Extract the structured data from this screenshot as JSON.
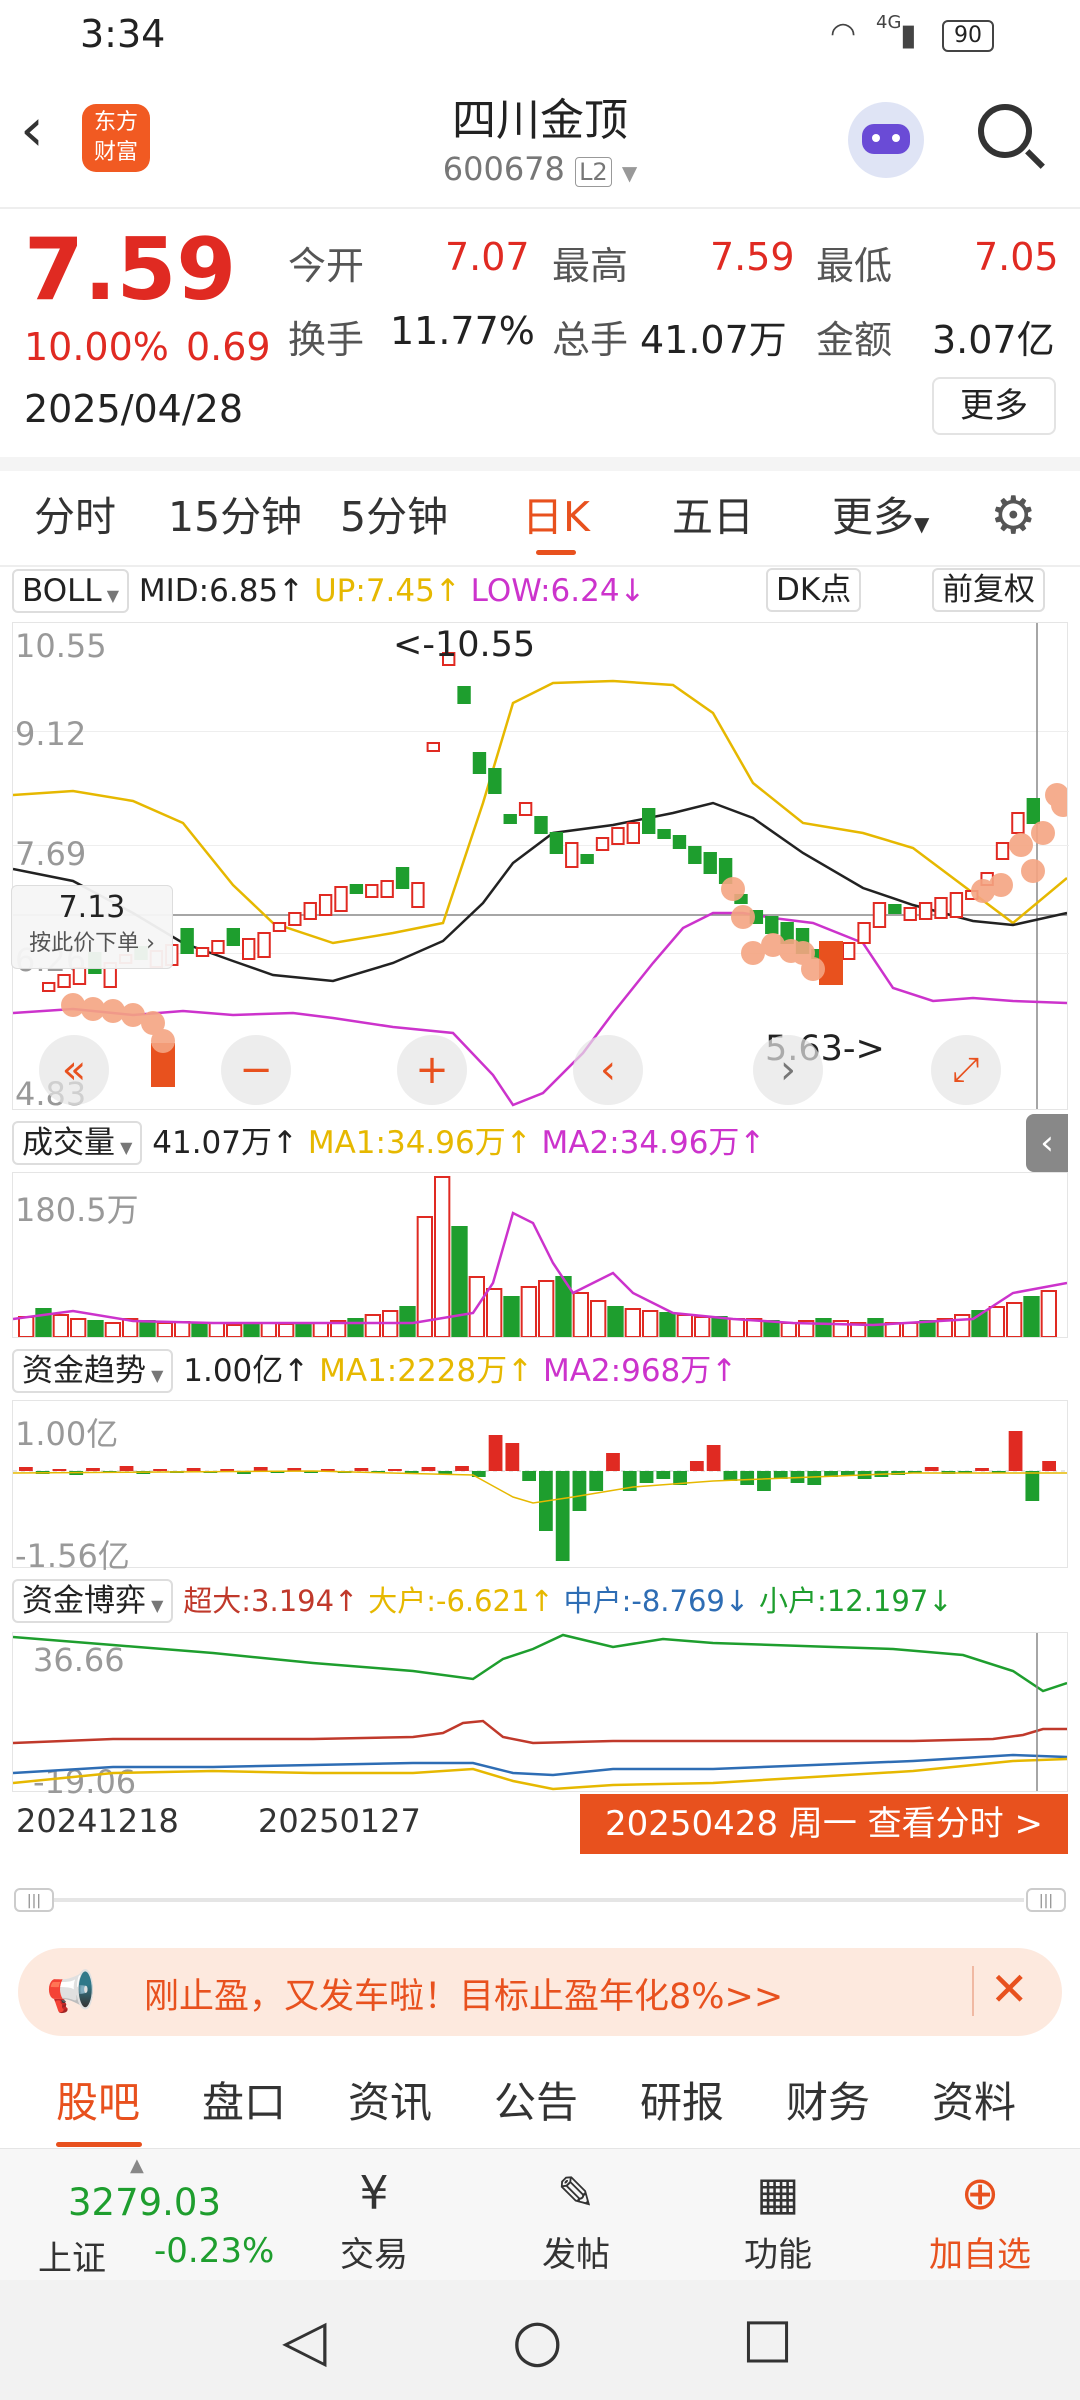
{
  "status": {
    "time": "3:34",
    "network": "4G",
    "battery": "90"
  },
  "header": {
    "logo": "东方财富",
    "stock_name": "四川金顶",
    "stock_code": "600678",
    "level": "L2"
  },
  "quote": {
    "price": "7.59",
    "change_pct": "10.00%",
    "change": "0.69",
    "date": "2025/04/28",
    "open_label": "今开",
    "open": "7.07",
    "high_label": "最高",
    "high": "7.59",
    "low_label": "最低",
    "low": "7.05",
    "turnover_label": "换手",
    "turnover": "11.77%",
    "volume_label": "总手",
    "volume": "41.07万",
    "amount_label": "金额",
    "amount": "3.07亿",
    "more": "更多"
  },
  "tabs": [
    "分时",
    "15分钟",
    "5分钟",
    "日K",
    "五日",
    "更多"
  ],
  "active_tab": "日K",
  "kline": {
    "indicator": "BOLL",
    "mid": "MID:6.85↑",
    "up": "UP:7.45↑",
    "low": "LOW:6.24↓",
    "dk": "DK点",
    "fq": "前复权",
    "y_top": "10.55",
    "y_2": "9.12",
    "y_3": "7.69",
    "y_4": "6.26",
    "y_bottom": "4.83",
    "cursor_price": "7.13",
    "cursor_action": "按此价下单",
    "max_marker": "<-10.55",
    "min_marker": "5.63->",
    "colors": {
      "up": "#e02a22",
      "down": "#1e9e2e",
      "mid": "#222222",
      "upper": "#e6b800",
      "lower": "#cc33cc"
    }
  },
  "volume": {
    "label": "成交量",
    "value": "41.07万↑",
    "ma1": "MA1:34.96万↑",
    "ma2": "MA2:34.96万↑",
    "y_top": "180.5万"
  },
  "fund_trend": {
    "label": "资金趋势",
    "value": "1.00亿↑",
    "ma1": "MA1:2228万↑",
    "ma2": "MA2:968万↑",
    "y_top": "1.00亿",
    "y_bottom": "-1.56亿"
  },
  "fund_game": {
    "label": "资金博弈",
    "super": "超大:3.194↑",
    "big": "大户:-6.621↑",
    "mid": "中户:-8.769↓",
    "small": "小户:12.197↓",
    "y_top": "36.66",
    "y_bottom": "-19.06"
  },
  "xaxis": {
    "d1": "20241218",
    "d2": "20250127",
    "current": "20250428 周一 查看分时 >"
  },
  "banner": {
    "text": "刚止盈，又发车啦！目标止盈年化8%>>"
  },
  "bottom_tabs": [
    "股吧",
    "盘口",
    "资讯",
    "公告",
    "研报",
    "财务",
    "资料"
  ],
  "index": {
    "name": "上证",
    "value": "3279.03",
    "change": "-0.23%"
  },
  "functions": [
    {
      "label": "交易",
      "icon": "trade-icon"
    },
    {
      "label": "发帖",
      "icon": "post-icon"
    },
    {
      "label": "功能",
      "icon": "grid-icon"
    },
    {
      "label": "加自选",
      "icon": "add-watchlist-icon"
    }
  ]
}
